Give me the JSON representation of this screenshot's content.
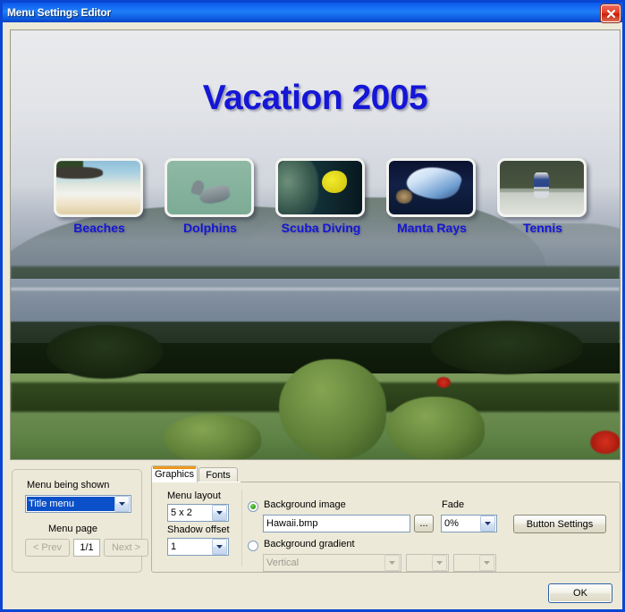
{
  "window": {
    "title": "Menu Settings Editor",
    "close_icon": "close-icon"
  },
  "preview": {
    "menu_title": "Vacation 2005",
    "background_image_name": "Hawaii.bmp",
    "buttons": [
      {
        "label": "Beaches",
        "art": "beach-thumbnail"
      },
      {
        "label": "Dolphins",
        "art": "dolphin-thumbnail"
      },
      {
        "label": "Scuba Diving",
        "art": "scuba-thumbnail"
      },
      {
        "label": "Manta Rays",
        "art": "manta-ray-thumbnail"
      },
      {
        "label": "Tennis",
        "art": "tennis-thumbnail"
      }
    ]
  },
  "menu_panel": {
    "menu_being_shown_label": "Menu being shown",
    "menu_being_shown_value": "Title menu",
    "menu_page_label": "Menu page",
    "prev_label": "< Prev",
    "page_value": "1/1",
    "next_label": "Next >"
  },
  "tabs": [
    {
      "label": "Graphics",
      "active": true
    },
    {
      "label": "Fonts",
      "active": false
    }
  ],
  "graphics": {
    "menu_layout_label": "Menu layout",
    "menu_layout_value": "5 x 2",
    "shadow_offset_label": "Shadow offset",
    "shadow_offset_value": "1",
    "background_image_label": "Background image",
    "background_image_value": "Hawaii.bmp",
    "browse_label": "...",
    "background_gradient_label": "Background gradient",
    "gradient_direction_value": "Vertical",
    "gradient_color1_value": "",
    "gradient_color2_value": "",
    "fade_label": "Fade",
    "fade_value": "0%",
    "button_settings_label": "Button Settings"
  },
  "footer": {
    "ok_label": "OK"
  },
  "colors": {
    "titlebar_blue": "#0f63f0",
    "dialog_face": "#ece9d8",
    "menu_text_blue": "#1516d6",
    "tab_accent_orange": "#f0a021",
    "selection_blue": "#0a50c8"
  }
}
